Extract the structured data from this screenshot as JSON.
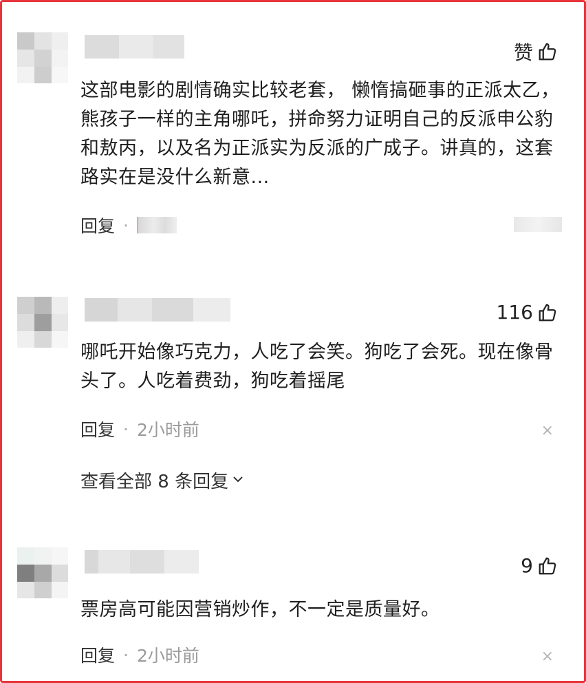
{
  "comments": [
    {
      "like_label": "赞",
      "text": "这部电影的剧情确实比较老套， 懒惰搞砸事的正派太乙，熊孩子一样的主角哪吒，拼命努力证明自己的反派申公豹和敖丙，以及名为正派实为反派的广成子。讲真的，这套路实在是没什么新意...",
      "reply_label": "回复",
      "separator": "·"
    },
    {
      "like_count": "116",
      "text": "哪吒开始像巧克力，人吃了会笑。狗吃了会死。现在像骨头了。人吃着费劲，狗吃着摇尾",
      "reply_label": "回复",
      "separator": "·",
      "time": "2小时前",
      "close_glyph": "×",
      "view_all": "查看全部 8 条回复"
    },
    {
      "like_count": "9",
      "text": "票房高可能因营销炒作，不一定是质量好。",
      "reply_label": "回复",
      "separator": "·",
      "time": "2小时前",
      "close_glyph": "×"
    }
  ],
  "icons": {
    "thumbs_up": "thumbs-up-icon",
    "chevron": "chevron-down-icon"
  },
  "colors": {
    "border": "#e8353b",
    "text": "#1f1f1f",
    "muted": "#9b9b9b"
  }
}
